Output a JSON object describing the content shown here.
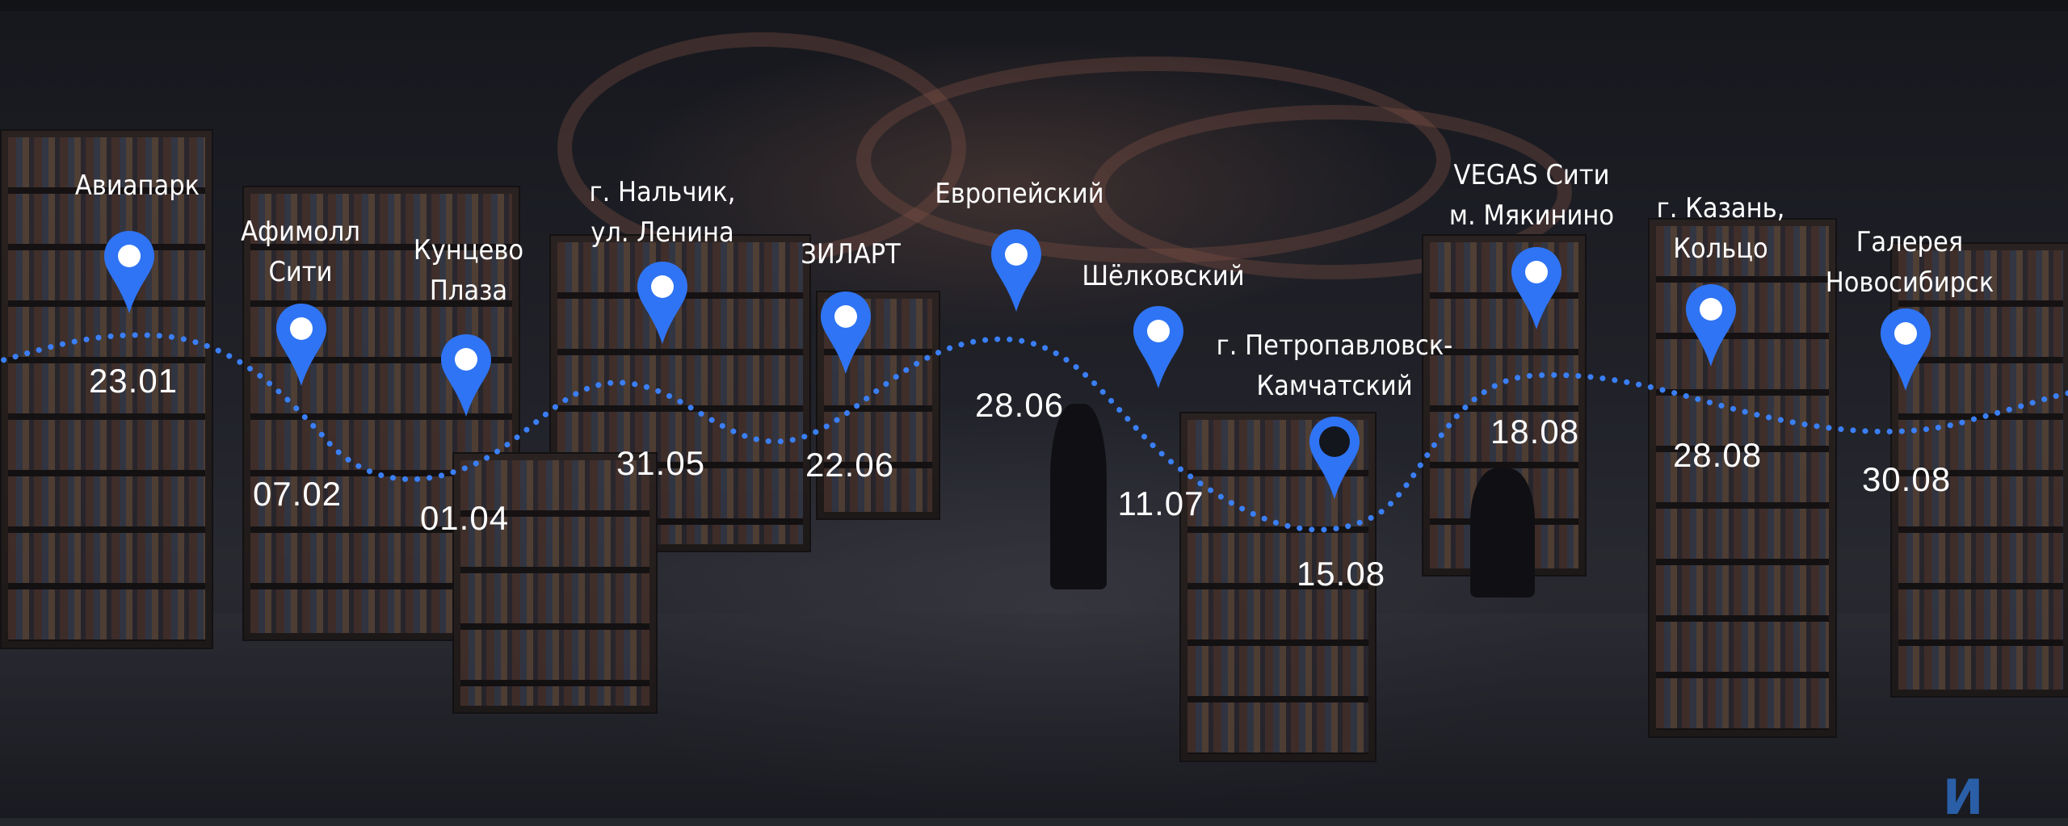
{
  "colors": {
    "marker": "#2f74f4",
    "marker_dark_center": "#13161c",
    "marker_hole": "#ffffff",
    "wave_dots": "#3a7ff6",
    "text": "#ffffff"
  },
  "icons": {
    "pin": "map-pin-icon",
    "logo": "brand-logo"
  },
  "stores": [
    {
      "name_lines": [
        "Авиапарк"
      ],
      "date": "23.01",
      "style": "blue"
    },
    {
      "name_lines": [
        "Афимолл",
        "Сити"
      ],
      "date": "07.02",
      "style": "blue"
    },
    {
      "name_lines": [
        "Кунцево",
        "Плаза"
      ],
      "date": "01.04",
      "style": "blue"
    },
    {
      "name_lines": [
        "г. Нальчик,",
        "ул. Ленина"
      ],
      "date": "31.05",
      "style": "blue"
    },
    {
      "name_lines": [
        "ЗИЛАРТ"
      ],
      "date": "22.06",
      "style": "blue"
    },
    {
      "name_lines": [
        "Европейский"
      ],
      "date": "28.06",
      "style": "blue"
    },
    {
      "name_lines": [
        "Шёлковский"
      ],
      "date": "11.07",
      "style": "blue"
    },
    {
      "name_lines": [
        "г. Петропавловск-",
        "Камчатский"
      ],
      "date": "15.08",
      "style": "dark"
    },
    {
      "name_lines": [
        "VEGAS Сити",
        "м. Мякинино"
      ],
      "date": "18.08",
      "style": "blue"
    },
    {
      "name_lines": [
        "г. Казань,",
        "Кольцо"
      ],
      "date": "28.08",
      "style": "blue"
    },
    {
      "name_lines": [
        "Галерея",
        "Новосибирск"
      ],
      "date": "30.08",
      "style": "blue"
    }
  ],
  "logo_text": "И"
}
